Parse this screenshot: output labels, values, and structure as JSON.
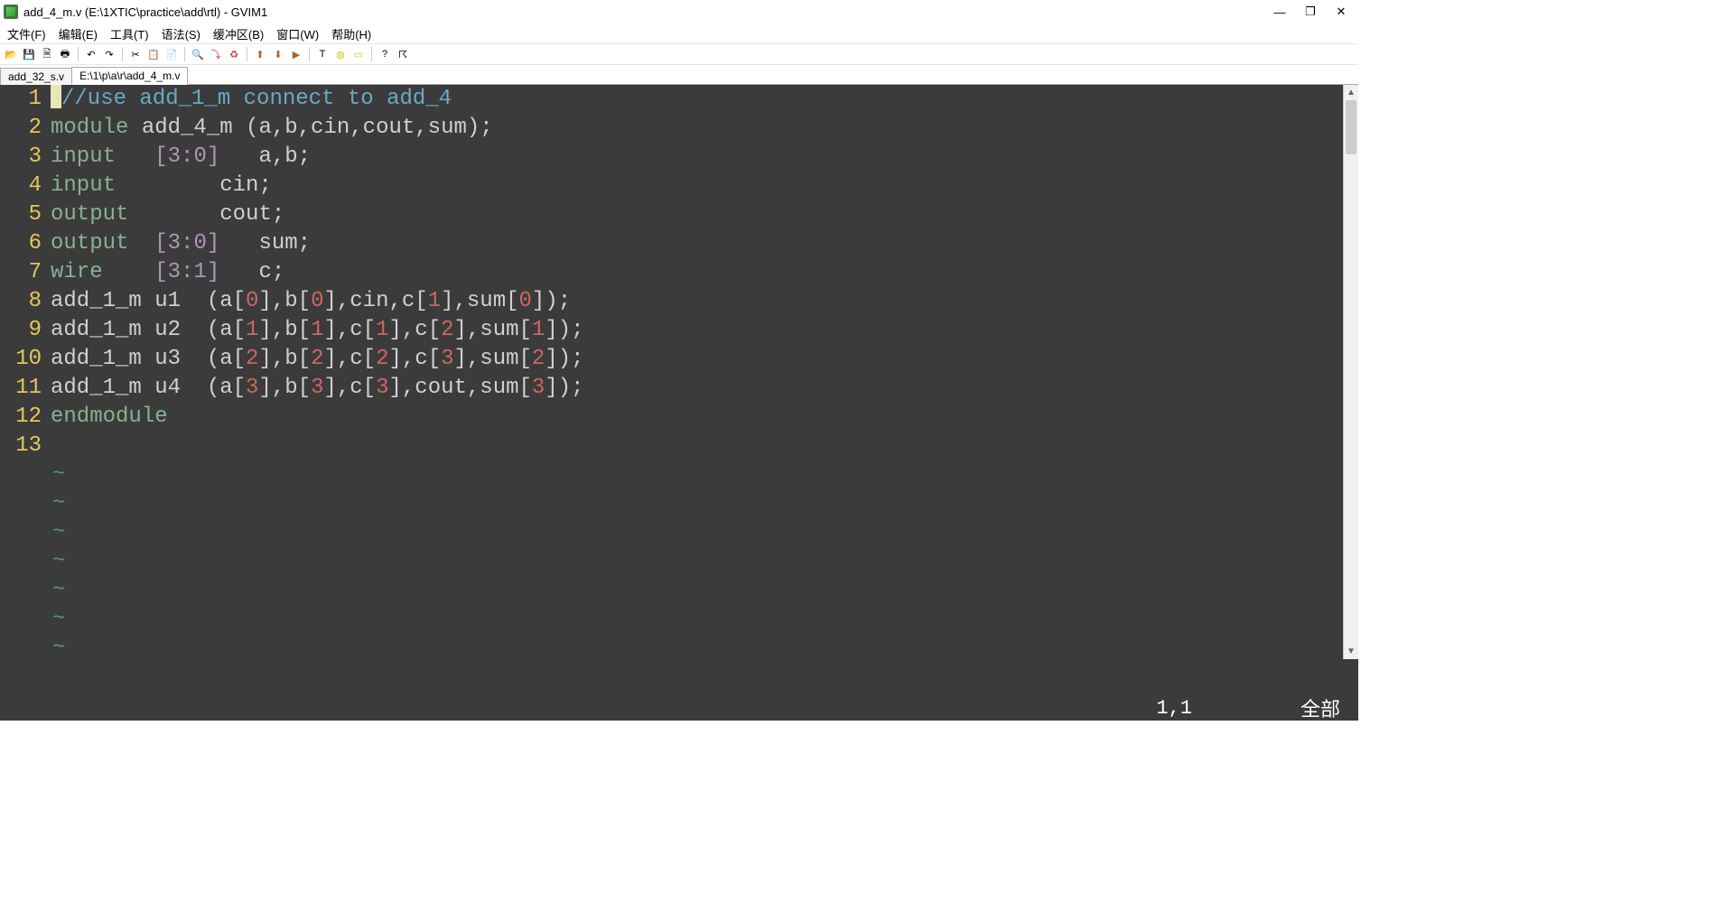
{
  "window": {
    "title": "add_4_m.v (E:\\1XTIC\\practice\\add\\rtl) - GVIM1",
    "min": "—",
    "max": "❐",
    "close": "✕"
  },
  "menu": {
    "file": "文件(F)",
    "edit": "编辑(E)",
    "tools": "工具(T)",
    "syntax": "语法(S)",
    "buffers": "缓冲区(B)",
    "window": "窗口(W)",
    "help": "帮助(H)"
  },
  "tabs": {
    "t0": "add_32_s.v",
    "t1": "E:\\1\\p\\a\\r\\add_4_m.v"
  },
  "lines": {
    "n1": "1",
    "n2": "2",
    "n3": "3",
    "n4": "4",
    "n5": "5",
    "n6": "6",
    "n7": "7",
    "n8": "8",
    "n9": "9",
    "n10": "10",
    "n11": "11",
    "n12": "12",
    "n13": "13"
  },
  "code": {
    "l1_comment": "/use add_1_m connect to add_4",
    "l1_slash": "/",
    "l2_kw": "module",
    "l2_rest": " add_4_m (a,b,cin,cout,sum);",
    "l3_kw": "input",
    "l3_range": "[3:0]",
    "l3_rest": "   a,b;",
    "l4_kw": "input",
    "l4_rest": "        cin;",
    "l5_kw": "output",
    "l5_rest": "       cout;",
    "l6_kw": "output",
    "l6_range": "[3:0]",
    "l6_rest": "   sum;",
    "l7_kw": "wire",
    "l7_range": "[3:1]",
    "l7_rest": "   c;",
    "l8_a": "add_1_m u1  (a[",
    "l8_0a": "0",
    "l8_b": "],b[",
    "l8_0b": "0",
    "l8_c": "],cin,c[",
    "l8_1": "1",
    "l8_d": "],sum[",
    "l8_0c": "0",
    "l8_e": "]);",
    "l9_a": "add_1_m u2  (a[",
    "l9_1a": "1",
    "l9_b": "],b[",
    "l9_1b": "1",
    "l9_c": "],c[",
    "l9_1c": "1",
    "l9_d": "],c[",
    "l9_2": "2",
    "l9_e": "],sum[",
    "l9_1d": "1",
    "l9_f": "]);",
    "l10_a": "add_1_m u3  (a[",
    "l10_2a": "2",
    "l10_b": "],b[",
    "l10_2b": "2",
    "l10_c": "],c[",
    "l10_2c": "2",
    "l10_d": "],c[",
    "l10_3": "3",
    "l10_e": "],sum[",
    "l10_2d": "2",
    "l10_f": "]);",
    "l11_a": "add_1_m u4  (a[",
    "l11_3a": "3",
    "l11_b": "],b[",
    "l11_3b": "3",
    "l11_c": "],c[",
    "l11_3c": "3",
    "l11_d": "],cout,sum[",
    "l11_3d": "3",
    "l11_e": "]);",
    "l12_kw": "endmodule",
    "tilde": "~"
  },
  "status": {
    "pos": "1,1",
    "all": "全部"
  }
}
